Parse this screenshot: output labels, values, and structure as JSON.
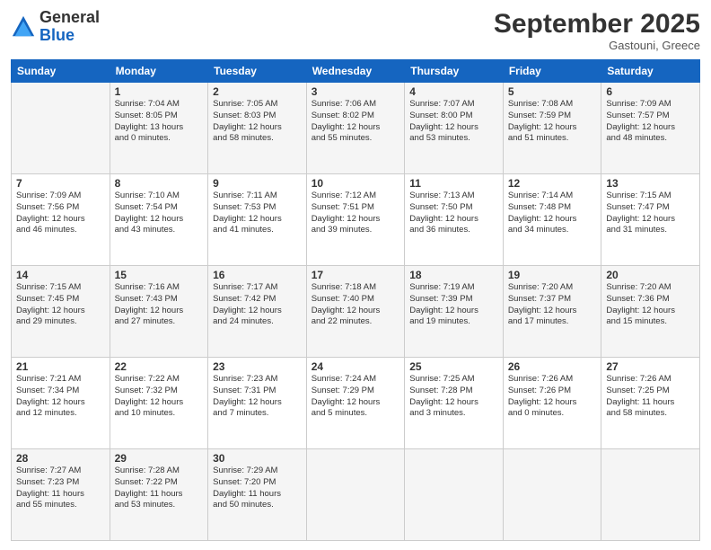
{
  "logo": {
    "general": "General",
    "blue": "Blue"
  },
  "header": {
    "month": "September 2025",
    "location": "Gastouni, Greece"
  },
  "days_of_week": [
    "Sunday",
    "Monday",
    "Tuesday",
    "Wednesday",
    "Thursday",
    "Friday",
    "Saturday"
  ],
  "weeks": [
    [
      {
        "day": "",
        "info": ""
      },
      {
        "day": "1",
        "info": "Sunrise: 7:04 AM\nSunset: 8:05 PM\nDaylight: 13 hours\nand 0 minutes."
      },
      {
        "day": "2",
        "info": "Sunrise: 7:05 AM\nSunset: 8:03 PM\nDaylight: 12 hours\nand 58 minutes."
      },
      {
        "day": "3",
        "info": "Sunrise: 7:06 AM\nSunset: 8:02 PM\nDaylight: 12 hours\nand 55 minutes."
      },
      {
        "day": "4",
        "info": "Sunrise: 7:07 AM\nSunset: 8:00 PM\nDaylight: 12 hours\nand 53 minutes."
      },
      {
        "day": "5",
        "info": "Sunrise: 7:08 AM\nSunset: 7:59 PM\nDaylight: 12 hours\nand 51 minutes."
      },
      {
        "day": "6",
        "info": "Sunrise: 7:09 AM\nSunset: 7:57 PM\nDaylight: 12 hours\nand 48 minutes."
      }
    ],
    [
      {
        "day": "7",
        "info": "Sunrise: 7:09 AM\nSunset: 7:56 PM\nDaylight: 12 hours\nand 46 minutes."
      },
      {
        "day": "8",
        "info": "Sunrise: 7:10 AM\nSunset: 7:54 PM\nDaylight: 12 hours\nand 43 minutes."
      },
      {
        "day": "9",
        "info": "Sunrise: 7:11 AM\nSunset: 7:53 PM\nDaylight: 12 hours\nand 41 minutes."
      },
      {
        "day": "10",
        "info": "Sunrise: 7:12 AM\nSunset: 7:51 PM\nDaylight: 12 hours\nand 39 minutes."
      },
      {
        "day": "11",
        "info": "Sunrise: 7:13 AM\nSunset: 7:50 PM\nDaylight: 12 hours\nand 36 minutes."
      },
      {
        "day": "12",
        "info": "Sunrise: 7:14 AM\nSunset: 7:48 PM\nDaylight: 12 hours\nand 34 minutes."
      },
      {
        "day": "13",
        "info": "Sunrise: 7:15 AM\nSunset: 7:47 PM\nDaylight: 12 hours\nand 31 minutes."
      }
    ],
    [
      {
        "day": "14",
        "info": "Sunrise: 7:15 AM\nSunset: 7:45 PM\nDaylight: 12 hours\nand 29 minutes."
      },
      {
        "day": "15",
        "info": "Sunrise: 7:16 AM\nSunset: 7:43 PM\nDaylight: 12 hours\nand 27 minutes."
      },
      {
        "day": "16",
        "info": "Sunrise: 7:17 AM\nSunset: 7:42 PM\nDaylight: 12 hours\nand 24 minutes."
      },
      {
        "day": "17",
        "info": "Sunrise: 7:18 AM\nSunset: 7:40 PM\nDaylight: 12 hours\nand 22 minutes."
      },
      {
        "day": "18",
        "info": "Sunrise: 7:19 AM\nSunset: 7:39 PM\nDaylight: 12 hours\nand 19 minutes."
      },
      {
        "day": "19",
        "info": "Sunrise: 7:20 AM\nSunset: 7:37 PM\nDaylight: 12 hours\nand 17 minutes."
      },
      {
        "day": "20",
        "info": "Sunrise: 7:20 AM\nSunset: 7:36 PM\nDaylight: 12 hours\nand 15 minutes."
      }
    ],
    [
      {
        "day": "21",
        "info": "Sunrise: 7:21 AM\nSunset: 7:34 PM\nDaylight: 12 hours\nand 12 minutes."
      },
      {
        "day": "22",
        "info": "Sunrise: 7:22 AM\nSunset: 7:32 PM\nDaylight: 12 hours\nand 10 minutes."
      },
      {
        "day": "23",
        "info": "Sunrise: 7:23 AM\nSunset: 7:31 PM\nDaylight: 12 hours\nand 7 minutes."
      },
      {
        "day": "24",
        "info": "Sunrise: 7:24 AM\nSunset: 7:29 PM\nDaylight: 12 hours\nand 5 minutes."
      },
      {
        "day": "25",
        "info": "Sunrise: 7:25 AM\nSunset: 7:28 PM\nDaylight: 12 hours\nand 3 minutes."
      },
      {
        "day": "26",
        "info": "Sunrise: 7:26 AM\nSunset: 7:26 PM\nDaylight: 12 hours\nand 0 minutes."
      },
      {
        "day": "27",
        "info": "Sunrise: 7:26 AM\nSunset: 7:25 PM\nDaylight: 11 hours\nand 58 minutes."
      }
    ],
    [
      {
        "day": "28",
        "info": "Sunrise: 7:27 AM\nSunset: 7:23 PM\nDaylight: 11 hours\nand 55 minutes."
      },
      {
        "day": "29",
        "info": "Sunrise: 7:28 AM\nSunset: 7:22 PM\nDaylight: 11 hours\nand 53 minutes."
      },
      {
        "day": "30",
        "info": "Sunrise: 7:29 AM\nSunset: 7:20 PM\nDaylight: 11 hours\nand 50 minutes."
      },
      {
        "day": "",
        "info": ""
      },
      {
        "day": "",
        "info": ""
      },
      {
        "day": "",
        "info": ""
      },
      {
        "day": "",
        "info": ""
      }
    ]
  ]
}
